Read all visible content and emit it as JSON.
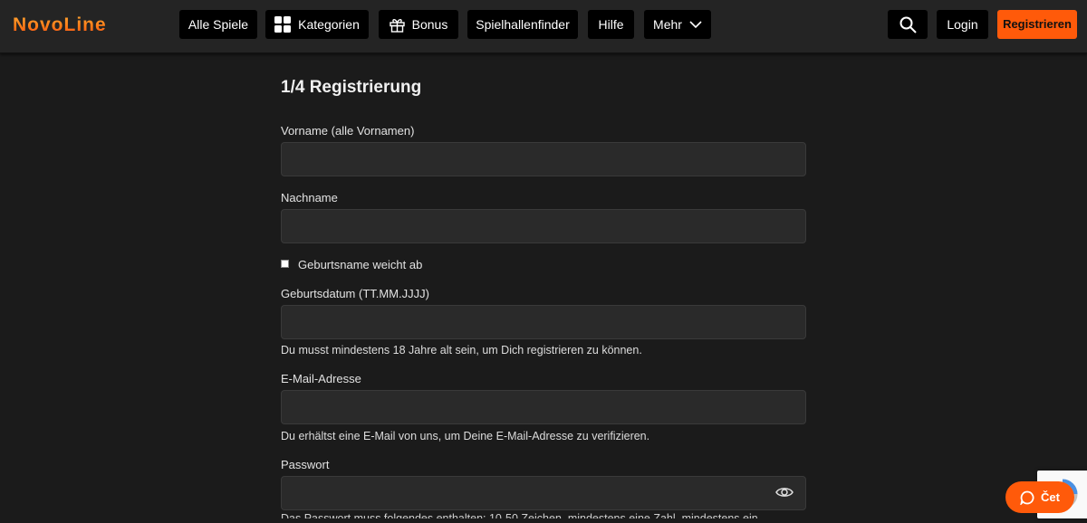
{
  "header": {
    "logo": "NovoLine",
    "nav": [
      {
        "label": "Alle Spiele"
      },
      {
        "label": "Kategorien"
      },
      {
        "label": "Bonus"
      },
      {
        "label": "Spielhallenfinder"
      },
      {
        "label": "Hilfe"
      },
      {
        "label": "Mehr"
      }
    ],
    "login": "Login",
    "register": "Registrieren"
  },
  "form": {
    "title": "1/4 Registrierung",
    "firstname_label": "Vorname (alle Vornamen)",
    "firstname_value": "",
    "lastname_label": "Nachname",
    "lastname_value": "",
    "birthname_checkbox_label": "Geburtsname weicht ab",
    "birthname_checked": false,
    "birthdate_label": "Geburtsdatum (TT.MM.JJJJ)",
    "birthdate_value": "",
    "birthdate_hint": "Du musst mindestens 18 Jahre alt sein, um Dich registrieren zu können.",
    "email_label": "E-Mail-Adresse",
    "email_value": "",
    "email_hint": "Du erhältst eine E-Mail von uns, um Deine E-Mail-Adresse zu verifizieren.",
    "password_label": "Passwort",
    "password_value": "",
    "password_hint": "Das Passwort muss folgendes enthalten: 10-50 Zeichen, mindestens eine Zahl, mindestens ein"
  },
  "chat": {
    "label": "Čet"
  },
  "colors": {
    "accent": "#ff5a0a",
    "background": "#1b1b1b",
    "header": "#242424"
  }
}
